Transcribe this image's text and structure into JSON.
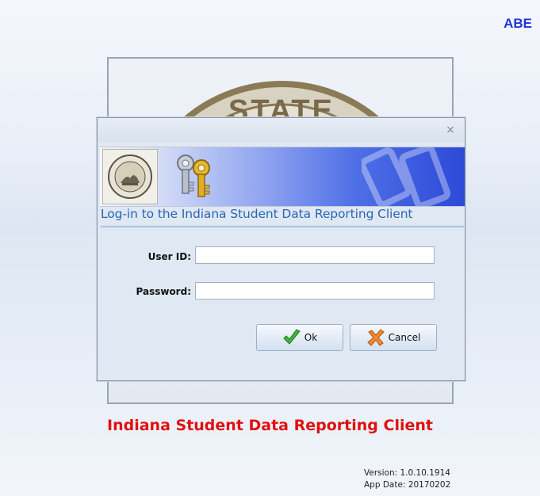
{
  "corner_label": "ABE",
  "seal_text": "STATE",
  "app_title": "Indiana Student Data Reporting Client",
  "version": {
    "version_line": "Version: 1.0.10.1914",
    "app_date_line": "App Date: 20170202"
  },
  "dialog": {
    "close_glyph": "×",
    "heading": "Log-in to the Indiana Student Data Reporting Client",
    "user_id": {
      "label": "User ID:",
      "value": "",
      "placeholder": ""
    },
    "password": {
      "label": "Password:",
      "value": "",
      "placeholder": ""
    },
    "buttons": {
      "ok": "Ok",
      "cancel": "Cancel"
    }
  },
  "icons": {
    "seal": "state-seal-icon",
    "keys": "keys-icon",
    "ok": "checkmark-icon",
    "cancel": "cross-icon",
    "close": "close-icon"
  },
  "colors": {
    "corner_label": "#1f34d6",
    "app_title": "#e11010",
    "heading": "#2b66b5",
    "banner_end": "#2d49d8"
  }
}
